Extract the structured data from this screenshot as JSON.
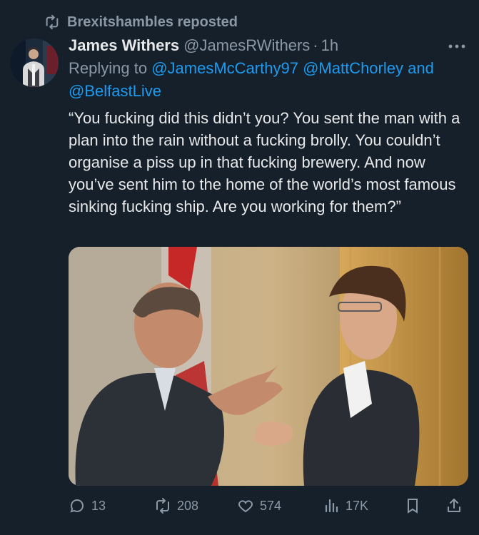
{
  "repost": {
    "icon": "repost-icon",
    "text": "Brexitshambles reposted"
  },
  "author": {
    "name": "James Withers",
    "handle": "@JamesRWithers",
    "separator": "·",
    "time": "1h"
  },
  "more_icon": "more-icon",
  "reply": {
    "prefix": "Replying to",
    "mentions": [
      "@JamesMcCarthy97",
      "@MattChorley"
    ],
    "joiner": "and",
    "last_mention": "@BelfastLive"
  },
  "tweet_text": "“You fucking did this didn’t you? You sent the man with a plan into the rain without a fucking brolly. You couldn’t organise a piss up in that fucking brewery. And now you’ve sent him to the home of the world’s most famous sinking fucking ship. Are you working for them?”",
  "actions": {
    "replies": "13",
    "reposts": "208",
    "likes": "574",
    "views": "17K"
  },
  "colors": {
    "background": "#15202b",
    "text": "#e7e9ea",
    "secondary": "#8b98a5",
    "link": "#1d9bf0"
  }
}
